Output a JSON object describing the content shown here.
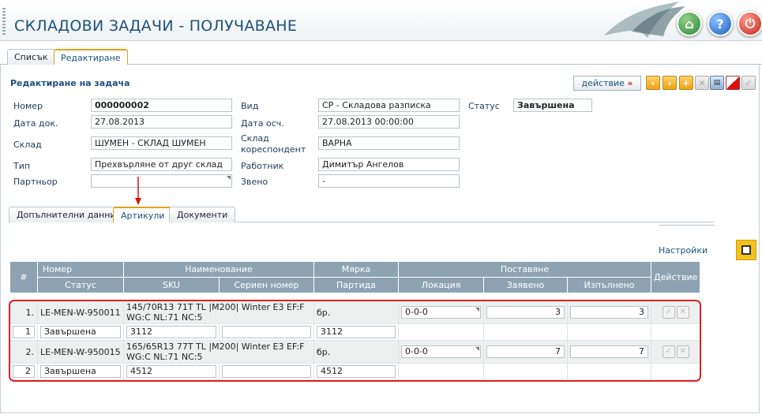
{
  "header": {
    "title": "СКЛАДОВИ ЗАДАЧИ - ПОЛУЧАВАНЕ"
  },
  "top_tabs": [
    {
      "label": "Списък"
    },
    {
      "label": "Редактиране"
    }
  ],
  "form": {
    "section_title": "Редактиране на задача",
    "action_label": "действие",
    "action_arrow": "»",
    "nomer": {
      "label": "Номер",
      "value": "000000002"
    },
    "vid": {
      "label": "Вид",
      "value": "СР - Складова разписка"
    },
    "status": {
      "label": "Статус",
      "value": "Завършена"
    },
    "data_dok": {
      "label": "Дата док.",
      "value": "27.08.2013"
    },
    "data_osch": {
      "label": "Дата осч.",
      "value": "27.08.2013 00:00:00"
    },
    "sklad": {
      "label": "Склад",
      "value": "ШУМЕН - СКЛАД ШУМЕН"
    },
    "sklad_kor": {
      "label1": "Склад",
      "label2": "кореспондент",
      "value": "ВАРНА"
    },
    "tip": {
      "label": "Тип",
      "value": "Прехвърляне от друг склад"
    },
    "rabotnik": {
      "label": "Работник",
      "value": "Димитър Ангелов"
    },
    "partnior": {
      "label": "Партньор",
      "value": ""
    },
    "zveno": {
      "label": "Звено",
      "value": "-"
    }
  },
  "sub_tabs": [
    {
      "label": "Допълнителни данни"
    },
    {
      "label": "Артикули"
    },
    {
      "label": "Документи"
    }
  ],
  "settings_label": "Настройки",
  "grid": {
    "headers": {
      "hash": "#",
      "nomer": "Номер",
      "naimenovanie": "Наименование",
      "marka": "Мярка",
      "postavyane": "Поставяне",
      "deistvie": "Действие",
      "status": "Статус",
      "sku": "SKU",
      "serien": "Сериен номер",
      "partida": "Партида",
      "lokaciya": "Локация",
      "zayaveno": "Заявено",
      "izpalneno": "Изпълнено"
    },
    "rows": [
      {
        "idx": "1.",
        "nomer": "LE-MEN-W-950011",
        "name": "145/70R13 71T TL |M200| Winter E3 EF:F WG:C NL:71 NC:5",
        "unit": "бр.",
        "lokaciya": "0-0-0",
        "zayaveno": "3",
        "izpalneno": "3",
        "idx2": "1",
        "status": "Завършена",
        "sku": "3112",
        "serien": "",
        "partida": "3112"
      },
      {
        "idx": "2.",
        "nomer": "LE-MEN-W-950015",
        "name": "165/65R13 77T TL |M200| Winter E3 EF:F WG:C NL:71 NC:5",
        "unit": "бр.",
        "lokaciya": "0-0-0",
        "zayaveno": "7",
        "izpalneno": "7",
        "idx2": "2",
        "status": "Завършена",
        "sku": "4512",
        "serien": "",
        "partida": "4512"
      }
    ]
  }
}
